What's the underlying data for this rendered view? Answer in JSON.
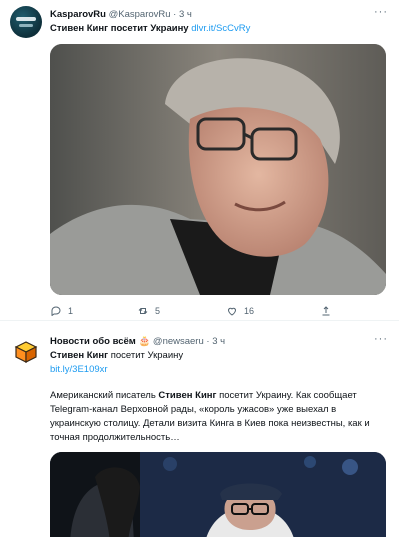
{
  "tweet1": {
    "author_name": "KasparovRu",
    "author_handle": "@KasparovRu",
    "separator": "·",
    "time": "3 ч",
    "more": "···",
    "text_prefix": "Стивен Кинг посетит Украину",
    "link": "dlvr.it/ScCvRy",
    "actions": {
      "replies": "1",
      "retweets": "5",
      "likes": "16"
    }
  },
  "tweet2": {
    "author_name": "Новости обо всём",
    "author_emoji": "🎂",
    "author_handle": "@newsaeru",
    "separator": "·",
    "time": "3 ч",
    "more": "···",
    "title_bold": "Стивен Кинг",
    "title_rest": " посетит Украину",
    "link": "bit.ly/3E109xr",
    "body_part1": "Американский писатель ",
    "body_bold": "Стивен Кинг",
    "body_part2": " посетит Украину. Как сообщает Telegram-канал Верховной рады, «король ужасов» уже выехал в украинскую столицу. Детали визита Кинга в Киев пока неизвестны, как и точная продолжительность…"
  },
  "colors": {
    "link": "#1d9bf0",
    "muted": "#536471",
    "text": "#0f1419"
  }
}
